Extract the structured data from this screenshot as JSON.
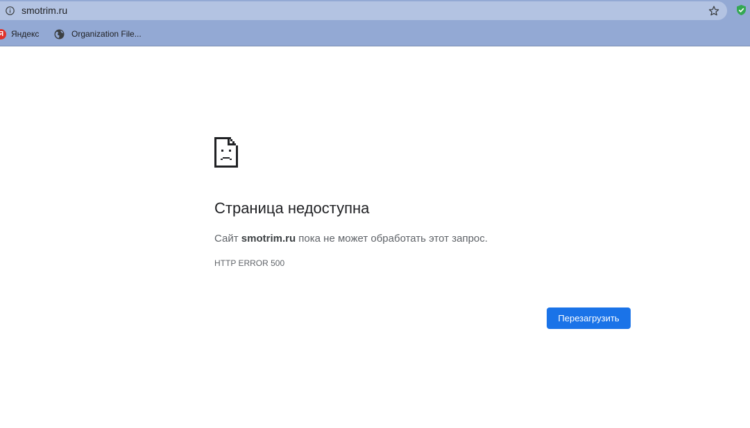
{
  "browser": {
    "url": "smotrim.ru",
    "bookmarks": [
      {
        "label": "Яндекс",
        "icon": "yandex-logo-icon",
        "glyph": "Я"
      },
      {
        "label": "Organization File...",
        "icon": "globe-icon"
      }
    ]
  },
  "error_page": {
    "title": "Страница недоступна",
    "message_prefix": "Сайт ",
    "message_site": "smotrim.ru",
    "message_suffix": " пока не может обработать этот запрос.",
    "error_code": "HTTP ERROR 500",
    "reload_label": "Перезагрузить",
    "icon": "sad-page-icon"
  },
  "colors": {
    "chrome_bg": "#93a9d4",
    "omnibox_bg": "#b3c3e2",
    "button_blue": "#1a73e8",
    "yandex_red": "#e0332b",
    "extension_green": "#34a853"
  }
}
